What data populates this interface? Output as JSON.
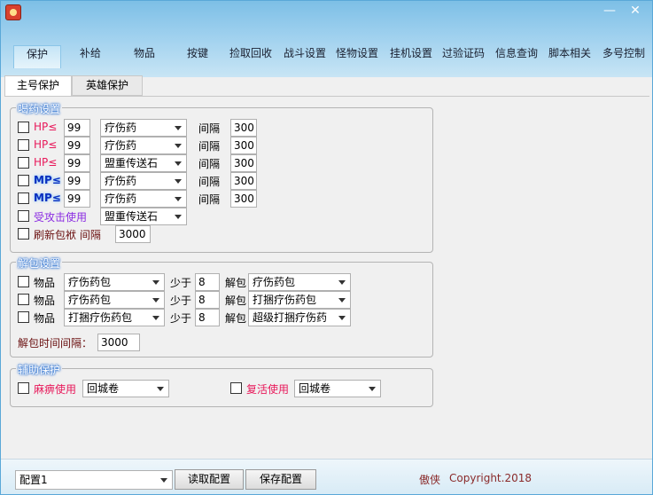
{
  "window": {
    "minimize": "—",
    "close": "✕"
  },
  "nav": [
    "保护",
    "补给",
    "物品",
    "按键",
    "捡取回收",
    "战斗设置",
    "怪物设置",
    "挂机设置",
    "过验证码",
    "信息查询",
    "脚本相关",
    "多号控制"
  ],
  "tabs": [
    "主号保护",
    "英雄保护"
  ],
  "drug": {
    "legend": "喝药设置",
    "interval_label": "间隔",
    "rows": [
      {
        "label": "HP≤",
        "value": "99",
        "item": "疗伤药",
        "interval": "300"
      },
      {
        "label": "HP≤",
        "value": "99",
        "item": "疗伤药",
        "interval": "300"
      },
      {
        "label": "HP≤",
        "value": "99",
        "item": "盟重传送石",
        "interval": "300"
      },
      {
        "label": "MP≤",
        "value": "99",
        "item": "疗伤药",
        "interval": "300"
      },
      {
        "label": "MP≤",
        "value": "99",
        "item": "疗伤药",
        "interval": "300"
      }
    ],
    "attacked_label": "受攻击使用",
    "attacked_item": "盟重传送石",
    "refresh_label": "刷新包袱 间隔",
    "refresh_value": "3000"
  },
  "unpack": {
    "legend": "解包设置",
    "item_label": "物品",
    "less_label": "少于",
    "unpack_label": "解包",
    "rows": [
      {
        "item": "疗伤药包",
        "count": "8",
        "target": "疗伤药包"
      },
      {
        "item": "疗伤药包",
        "count": "8",
        "target": "打捆疗伤药包"
      },
      {
        "item": "打捆疗伤药包",
        "count": "8",
        "target": "超级打捆疗伤药"
      }
    ],
    "interval_label": "解包时间间隔：",
    "interval_value": "3000"
  },
  "assist": {
    "legend": "辅助保护",
    "paralysis_label": "麻痹使用",
    "paralysis_item": "回城卷",
    "revive_label": "复活使用",
    "revive_item": "回城卷"
  },
  "footer": {
    "config": "配置1",
    "read_btn": "读取配置",
    "save_btn": "保存配置",
    "author": "傲侠",
    "copyright": "Copyright.2018"
  }
}
